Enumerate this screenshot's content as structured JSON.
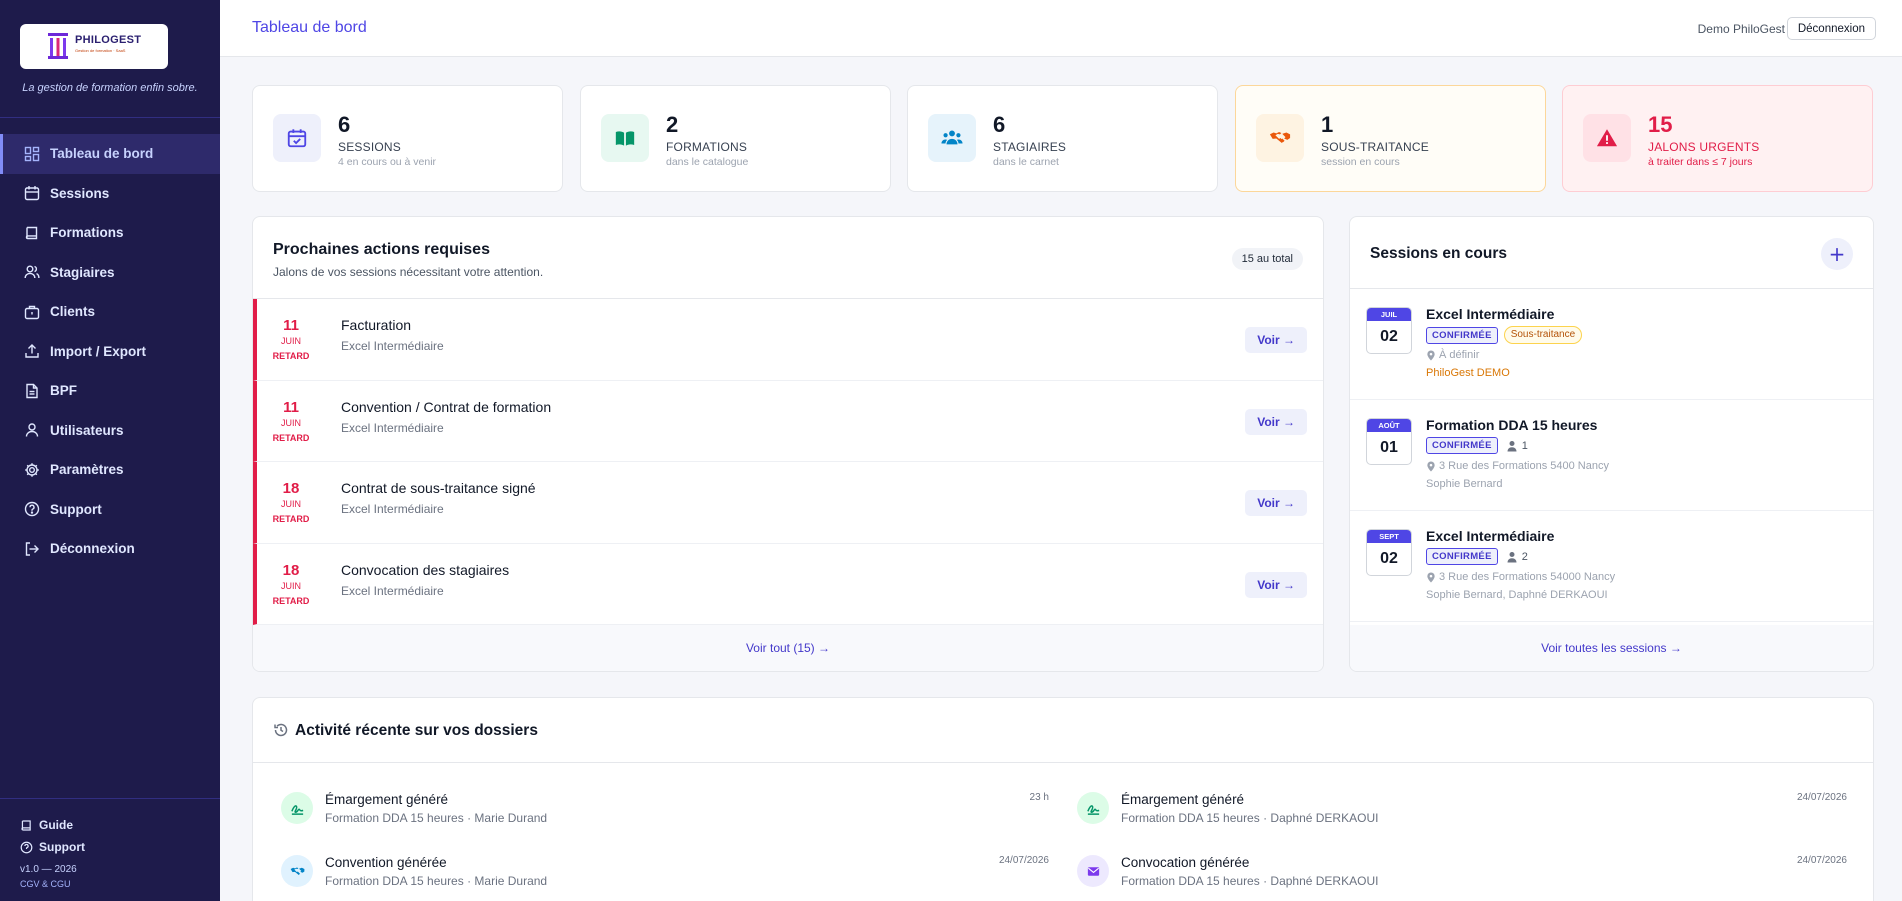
{
  "brand": {
    "name": "PHILOGEST",
    "small_print": "Gestion de formation · SaaS",
    "tagline": "La gestion de formation enfin sobre."
  },
  "sidebar": {
    "items": [
      {
        "label": "Tableau de bord",
        "icon": "dashboard-icon",
        "active": true
      },
      {
        "label": "Sessions",
        "icon": "calendar-icon"
      },
      {
        "label": "Formations",
        "icon": "book-icon"
      },
      {
        "label": "Stagiaires",
        "icon": "users-icon"
      },
      {
        "label": "Clients",
        "icon": "briefcase-icon"
      },
      {
        "label": "Import / Export",
        "icon": "upload-icon"
      },
      {
        "label": "BPF",
        "icon": "document-icon"
      },
      {
        "label": "Utilisateurs",
        "icon": "user-icon"
      },
      {
        "label": "Paramètres",
        "icon": "gear-icon"
      },
      {
        "label": "Support",
        "icon": "help-icon"
      },
      {
        "label": "Déconnexion",
        "icon": "logout-icon"
      }
    ],
    "bottom": {
      "guide": "Guide",
      "support": "Support",
      "version": "v1.0 — 2026",
      "cgv": "CGV & CGU"
    }
  },
  "header": {
    "title": "Tableau de bord",
    "user": "Demo PhiloGest",
    "logout": "Déconnexion"
  },
  "stats": [
    {
      "value": "6",
      "label": "SESSIONS",
      "sub": "4 en cours ou à venir",
      "icon": "calendar-check-icon",
      "color": "#4f46e5"
    },
    {
      "value": "2",
      "label": "FORMATIONS",
      "sub": "dans le catalogue",
      "icon": "open-book-icon",
      "color": "#059669"
    },
    {
      "value": "6",
      "label": "STAGIAIRES",
      "sub": "dans le carnet",
      "icon": "users-icon",
      "color": "#0284c7"
    },
    {
      "value": "1",
      "label": "SOUS-TRAITANCE",
      "sub": "session en cours",
      "icon": "handshake-icon",
      "color": "#ea580c"
    },
    {
      "value": "15",
      "label": "JALONS URGENTS",
      "sub": "à traiter dans ≤ 7 jours",
      "icon": "warning-icon",
      "color": "#e11d48"
    }
  ],
  "actions": {
    "title": "Prochaines actions requises",
    "subtitle": "Jalons de vos sessions nécessitant votre attention.",
    "total_badge": "15 au total",
    "rows": [
      {
        "day": "11",
        "month": "JUIN",
        "status": "RETARD",
        "title": "Facturation",
        "sub": "Excel Intermédiaire",
        "button": "Voir →"
      },
      {
        "day": "11",
        "month": "JUIN",
        "status": "RETARD",
        "title": "Convention / Contrat de formation",
        "sub": "Excel Intermédiaire",
        "button": "Voir →"
      },
      {
        "day": "18",
        "month": "JUIN",
        "status": "RETARD",
        "title": "Contrat de sous-traitance signé",
        "sub": "Excel Intermédiaire",
        "button": "Voir →"
      },
      {
        "day": "18",
        "month": "JUIN",
        "status": "RETARD",
        "title": "Convocation des stagiaires",
        "sub": "Excel Intermédiaire",
        "button": "Voir →"
      }
    ],
    "footer": "Voir tout (15) →"
  },
  "sessions": {
    "title": "Sessions en cours",
    "add": "+",
    "rows": [
      {
        "month": "JUIL",
        "day": "02",
        "title": "Excel Intermédiaire",
        "status": "CONFIRMÉE",
        "tag": "Sous-traitance",
        "count": "",
        "location": "À définir",
        "extra": "PhiloGest DEMO"
      },
      {
        "month": "AOÛT",
        "day": "01",
        "title": "Formation DDA 15 heures",
        "status": "CONFIRMÉE",
        "tag": "",
        "count": "1",
        "location": "3 Rue des Formations 5400 Nancy",
        "extra": "Sophie Bernard"
      },
      {
        "month": "SEPT",
        "day": "02",
        "title": "Excel Intermédiaire",
        "status": "CONFIRMÉE",
        "tag": "",
        "count": "2",
        "location": "3 Rue des Formations 54000 Nancy",
        "extra": "Sophie Bernard, Daphné DERKAOUI"
      }
    ],
    "footer": "Voir toutes les sessions →"
  },
  "activity": {
    "title": "Activité récente sur vos dossiers",
    "items": [
      {
        "title": "Émargement généré",
        "sub": "Formation DDA 15 heures · Marie Durand",
        "time": "23 h",
        "icon": "signature-icon",
        "color": "#059669",
        "bg": "#dcfce7"
      },
      {
        "title": "Émargement généré",
        "sub": "Formation DDA 15 heures · Daphné DERKAOUI",
        "time": "24/07/2026",
        "icon": "signature-icon",
        "color": "#059669",
        "bg": "#dcfce7"
      },
      {
        "title": "Convention générée",
        "sub": "Formation DDA 15 heures · Marie Durand",
        "time": "24/07/2026",
        "icon": "handshake-icon",
        "color": "#0284c7",
        "bg": "#e0f2fe"
      },
      {
        "title": "Convocation générée",
        "sub": "Formation DDA 15 heures · Daphné DERKAOUI",
        "time": "24/07/2026",
        "icon": "envelope-icon",
        "color": "#7c3aed",
        "bg": "#ede9fe"
      }
    ]
  }
}
